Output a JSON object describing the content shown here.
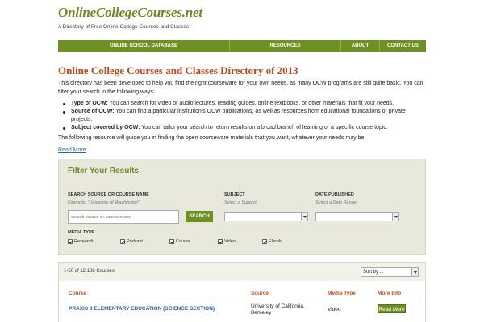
{
  "site": {
    "logo": "OnlineCollegeCourses.net",
    "tagline": "A Directory of Free Online College Courses and Classes"
  },
  "nav": [
    "ONLINE SCHOOL DATABASE",
    "RESOURCES",
    "ABOUT",
    "CONTACT US"
  ],
  "main": {
    "title": "Online College Courses and Classes Directory of 2013",
    "intro": "This directory has been developed to help you find the right courseware for your own needs, as many OCW programs are still quite basic. You can filter your search in the following ways:",
    "bullets": [
      {
        "label": "Type of OCW:",
        "text": " You can search for video or audio lectures, reading guides, online textbooks, or other materials that fit your needs."
      },
      {
        "label": "Source of OCW:",
        "text": " You can find a particular institution's OCW publications, as well as resources from educational foundations or private projects."
      },
      {
        "label": "Subject covered by OCW:",
        "text": " You can tailor your search to return results on a broad branch of learning or a specific course topic."
      }
    ],
    "guide": "The following resource will guide you in finding the open courseware materials that you want, whatever your needs may be.",
    "read_more": "Read More"
  },
  "filter": {
    "title": "Filter Your Results",
    "source_label": "SEARCH SOURCE OR COURSE NAME",
    "source_hint": "Example: \"University of Washington\"",
    "source_placeholder": "search source or course name",
    "search_button": "SEARCH",
    "subject_label": "SUBJECT",
    "subject_hint": "Select a Subject",
    "date_label": "DATE PUBLISHED",
    "date_hint": "Select a Date Range",
    "media_label": "MEDIA TYPE",
    "media": [
      "Research",
      "Podcast",
      "Course",
      "Video",
      "Ebook"
    ]
  },
  "results": {
    "count": "1-50 of 12,188 Courses",
    "sort_value": "Sort by ...",
    "headers": {
      "course": "Course",
      "source": "Source",
      "media": "Media Type",
      "more": "More Info"
    },
    "rows": [
      {
        "course": "PRAXIS II ELEMENTARY EDUCATION (SCIENCE SECTION)",
        "source_line1": "University of California,",
        "source_line2": "Berkeley",
        "media": "Video",
        "button": "Read More"
      }
    ]
  },
  "colors": {
    "accent_green": "#6f9022",
    "title_red": "#b9481c",
    "link_blue": "#2a6aa6"
  }
}
